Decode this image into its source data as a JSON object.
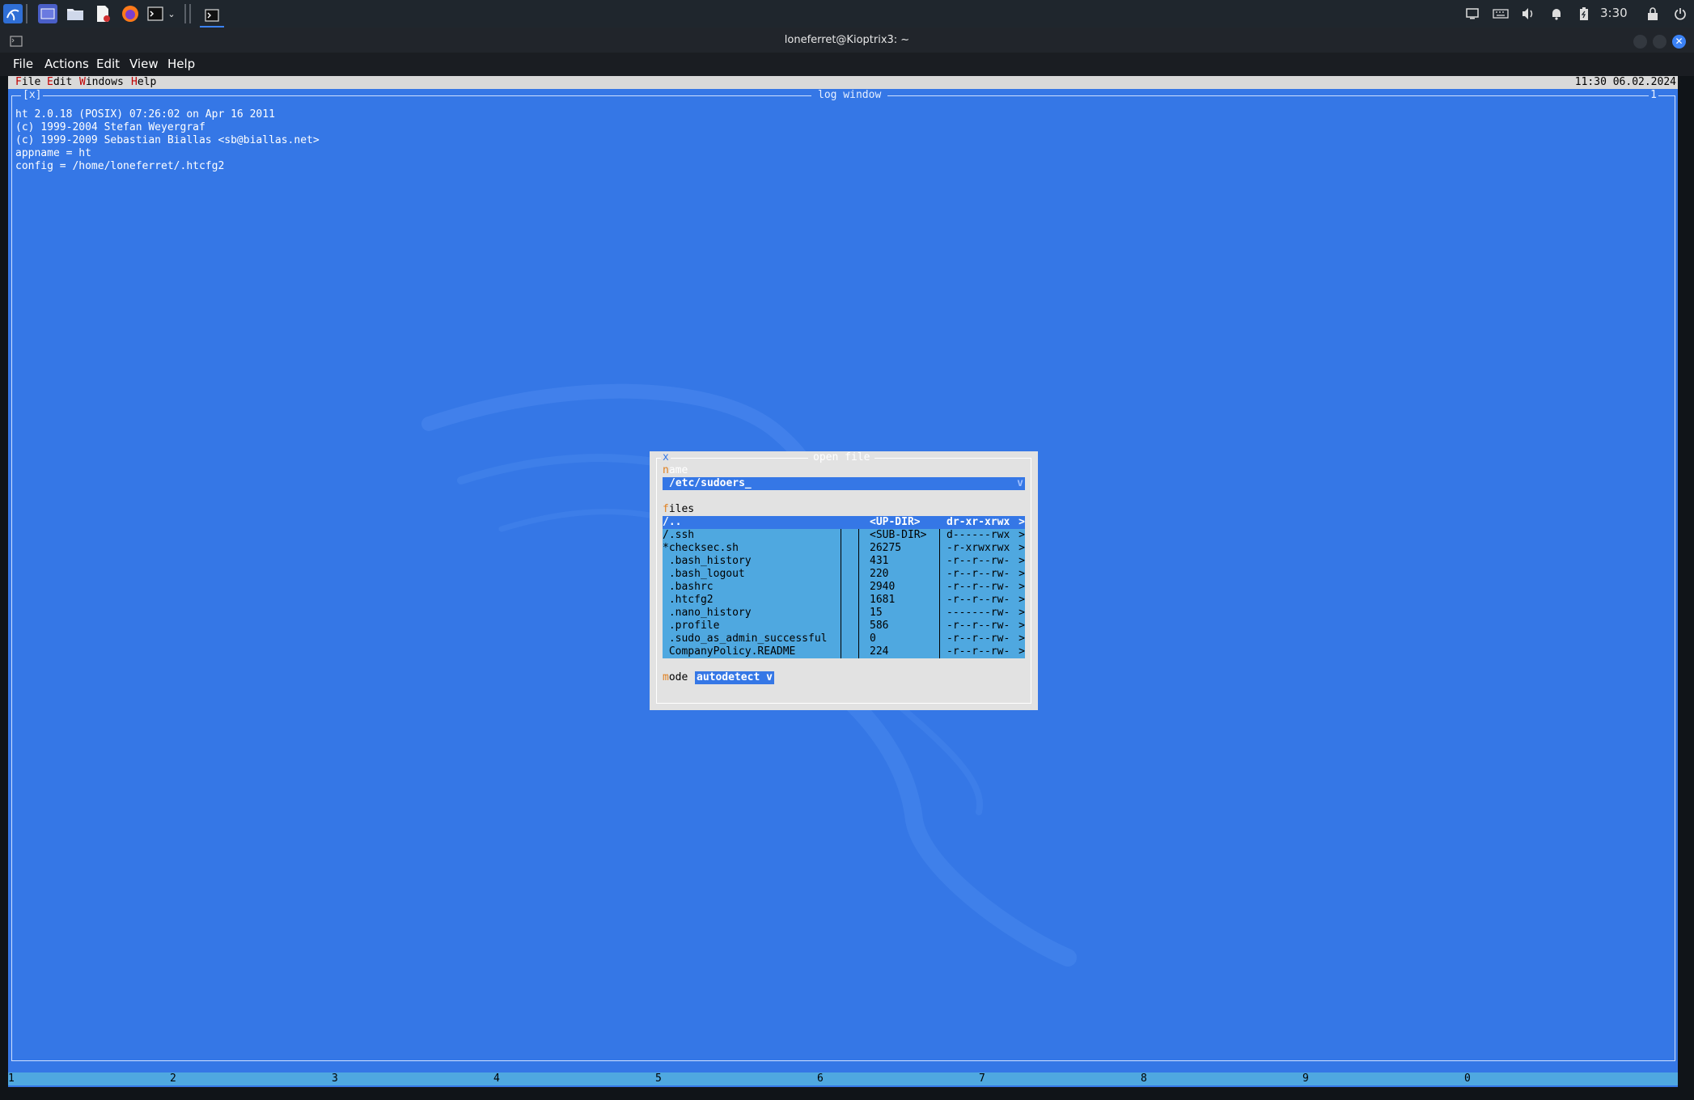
{
  "taskbar": {
    "launchers": [
      {
        "icon": "kali-menu-icon"
      },
      {
        "icon": "desktop-icon"
      },
      {
        "icon": "folder-icon"
      },
      {
        "icon": "text-editor-icon"
      },
      {
        "icon": "firefox-icon"
      },
      {
        "icon": "terminal-icon"
      },
      {
        "icon": "chevron-down-icon"
      }
    ],
    "active_task": {
      "icon": "terminal-icon"
    },
    "tray": [
      "screen-icon",
      "keyboard-icon",
      "volume-icon",
      "bell-icon",
      "battery-icon",
      "lock-icon",
      "power-icon"
    ],
    "clock": "3:30"
  },
  "window": {
    "title": "loneferret@Kioptrix3: ~"
  },
  "terminal_menu": [
    "File",
    "Actions",
    "Edit",
    "View",
    "Help"
  ],
  "ht": {
    "menu": [
      {
        "hotkey": "F",
        "rest": "ile"
      },
      {
        "hotkey": "E",
        "rest": "dit"
      },
      {
        "hotkey": "W",
        "rest": "indows"
      },
      {
        "hotkey": "H",
        "rest": "elp"
      }
    ],
    "datetime": "11:30 06.02.2024",
    "log_window": {
      "title": "log window",
      "close": "[x]",
      "number": "1",
      "lines": [
        "ht 2.0.18 (POSIX) 07:26:02 on Apr 16 2011",
        "(c) 1999-2004 Stefan Weyergraf",
        "(c) 1999-2009 Sebastian Biallas <sb@biallas.net>",
        "appname = ht",
        "config = /home/loneferret/.htcfg2"
      ]
    },
    "dialog": {
      "title": "open file",
      "close": "x",
      "name_label": {
        "hotkey": "n",
        "rest": "ame"
      },
      "name_value": "/etc/sudoers_",
      "name_dropdown": "v",
      "files_label": {
        "hotkey": "f",
        "rest": "iles"
      },
      "files": [
        {
          "name": "/..",
          "size": "<UP-DIR>",
          "perm": "dr-xr-xrwx",
          "arrow": ">",
          "selected": true
        },
        {
          "name": "/.ssh",
          "size": "<SUB-DIR>",
          "perm": "d------rwx",
          "arrow": ">"
        },
        {
          "name": "*checksec.sh",
          "size": "26275",
          "perm": "-r-xrwxrwx",
          "arrow": ">"
        },
        {
          "name": " .bash_history",
          "size": "431",
          "perm": "-r--r--rw-",
          "arrow": ">"
        },
        {
          "name": " .bash_logout",
          "size": "220",
          "perm": "-r--r--rw-",
          "arrow": ">"
        },
        {
          "name": " .bashrc",
          "size": "2940",
          "perm": "-r--r--rw-",
          "arrow": ">"
        },
        {
          "name": " .htcfg2",
          "size": "1681",
          "perm": "-r--r--rw-",
          "arrow": ">"
        },
        {
          "name": " .nano_history",
          "size": "15",
          "perm": "-------rw-",
          "arrow": ">"
        },
        {
          "name": " .profile",
          "size": "586",
          "perm": "-r--r--rw-",
          "arrow": ">"
        },
        {
          "name": " .sudo_as_admin_successful",
          "size": "0",
          "perm": "-r--r--rw-",
          "arrow": ">"
        },
        {
          "name": " CompanyPolicy.README",
          "size": "224",
          "perm": "-r--r--rw-",
          "arrow": ">"
        }
      ],
      "mode_label": {
        "hotkey": "m",
        "rest": "ode"
      },
      "mode_value": "autodetect v"
    },
    "keybar": [
      "1",
      "2",
      "3",
      "4",
      "5",
      "6",
      "7",
      "8",
      "9",
      "0"
    ]
  }
}
